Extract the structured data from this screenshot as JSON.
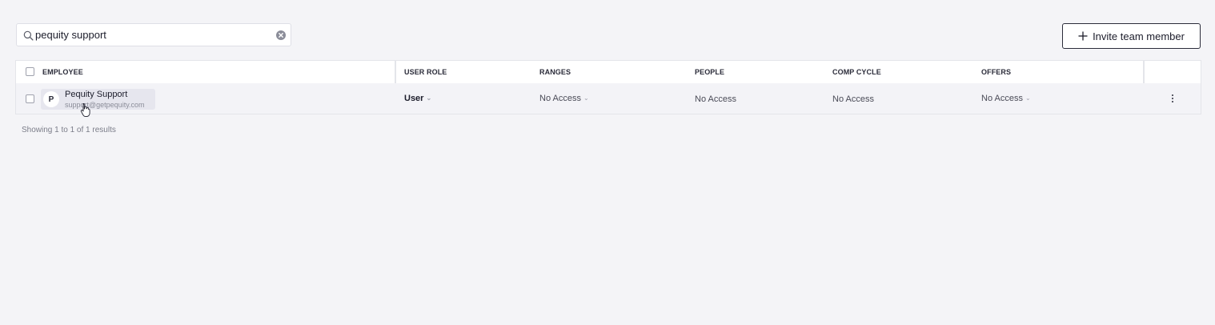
{
  "search": {
    "value": "pequity support",
    "placeholder": ""
  },
  "toolbar": {
    "invite_label": "Invite team member"
  },
  "table": {
    "columns": [
      "EMPLOYEE",
      "USER ROLE",
      "RANGES",
      "PEOPLE",
      "COMP CYCLE",
      "OFFERS"
    ],
    "rows": [
      {
        "avatar_initial": "P",
        "name": "Pequity Support",
        "email": "support@getpequity.com",
        "user_role": "User",
        "ranges": "No Access",
        "people": "No Access",
        "comp_cycle": "No Access",
        "offers": "No Access"
      }
    ]
  },
  "footer": {
    "results_text": "Showing 1 to 1 of 1 results"
  },
  "icons": {
    "search": "search-icon",
    "clear": "clear-circle-icon",
    "plus": "plus-icon",
    "chevron": "chevron-down-icon",
    "more": "more-vertical-icon",
    "cursor": "hand-pointer-icon"
  },
  "colors": {
    "background": "#f4f4f7",
    "row_highlight": "#f3f3f7",
    "border": "#e4e5ea",
    "text": "#1c1d2b"
  }
}
